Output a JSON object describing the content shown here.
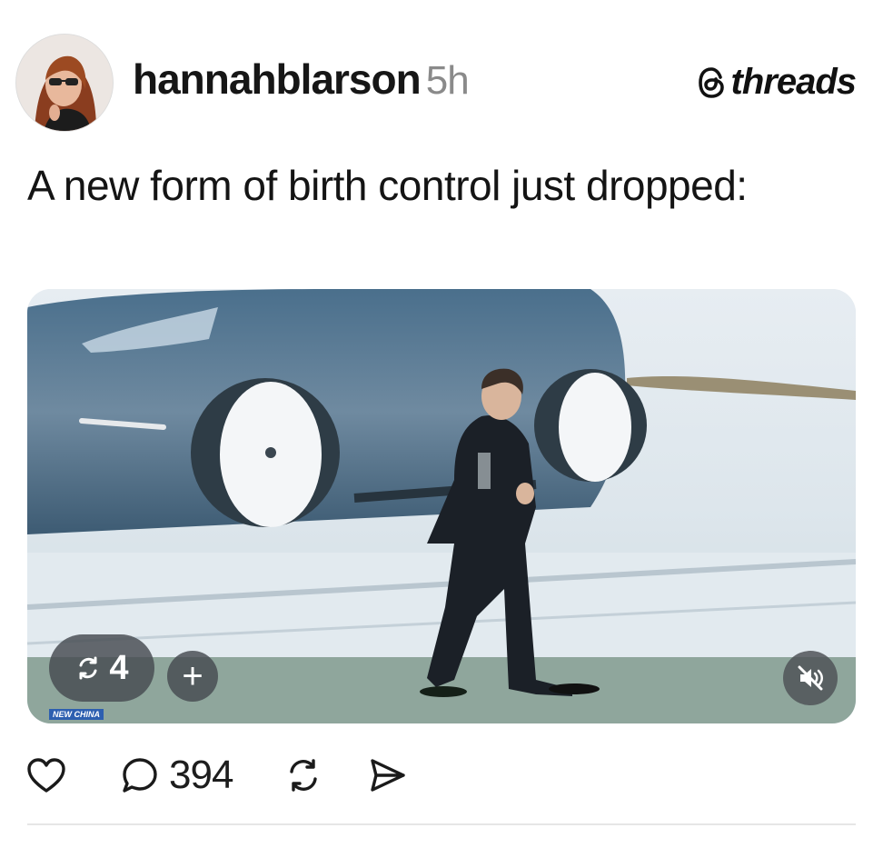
{
  "post": {
    "username": "hannahblarson",
    "time": "5h",
    "brand": "threads",
    "caption": "A new form of birth control just dropped:"
  },
  "media": {
    "repost_count": "4",
    "plus": "+",
    "watermark": "NEW CHINA"
  },
  "actions": {
    "reply_count": "394"
  },
  "icons": {
    "avatar": "profile-photo",
    "brand": "threads-logo-icon",
    "like": "heart-icon",
    "reply": "comment-icon",
    "repost": "repost-icon",
    "share": "send-icon",
    "mute": "speaker-muted-icon"
  }
}
